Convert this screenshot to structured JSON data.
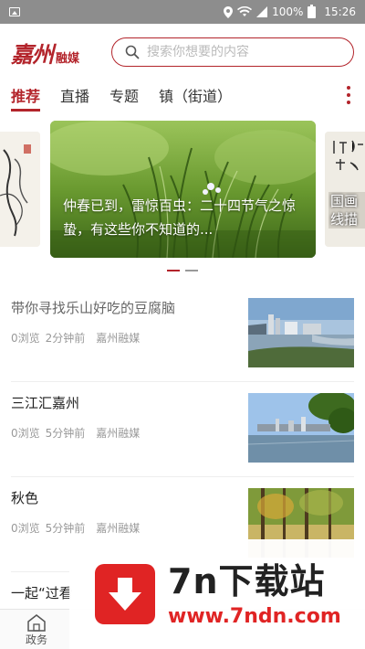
{
  "status_bar": {
    "battery": "100%",
    "time": "15:26"
  },
  "header": {
    "logo_mark": "嘉州",
    "logo_sub": "融媒",
    "search_placeholder": "搜索你想要的内容"
  },
  "tabs": [
    {
      "label": "推荐",
      "active": true
    },
    {
      "label": "直播",
      "active": false
    },
    {
      "label": "专题",
      "active": false
    },
    {
      "label": "镇（街道）",
      "active": false
    }
  ],
  "carousel": {
    "main_caption": "仲春已到，雷惊百虫：二十四节气之惊蛰，有这些你不知道的...",
    "right_partial_text": "国画\n线描"
  },
  "feed": [
    {
      "title": "带你寻找乐山好吃的豆腐脑",
      "views": "0浏览",
      "time": "2分钟前",
      "source": "嘉州融媒"
    },
    {
      "title": "三江汇嘉州",
      "views": "0浏览",
      "time": "5分钟前",
      "source": "嘉州融媒"
    },
    {
      "title": "秋色",
      "views": "0浏览",
      "time": "5分钟前",
      "source": "嘉州融媒"
    },
    {
      "title": "一起“过看",
      "views": "",
      "time": "",
      "source": ""
    }
  ],
  "bottom_nav": {
    "item_label": "政务"
  },
  "watermark": {
    "title": "7n下载站",
    "url": "www.7ndn.com"
  },
  "colors": {
    "accent": "#b3242b",
    "watermark_red": "#e02424"
  }
}
